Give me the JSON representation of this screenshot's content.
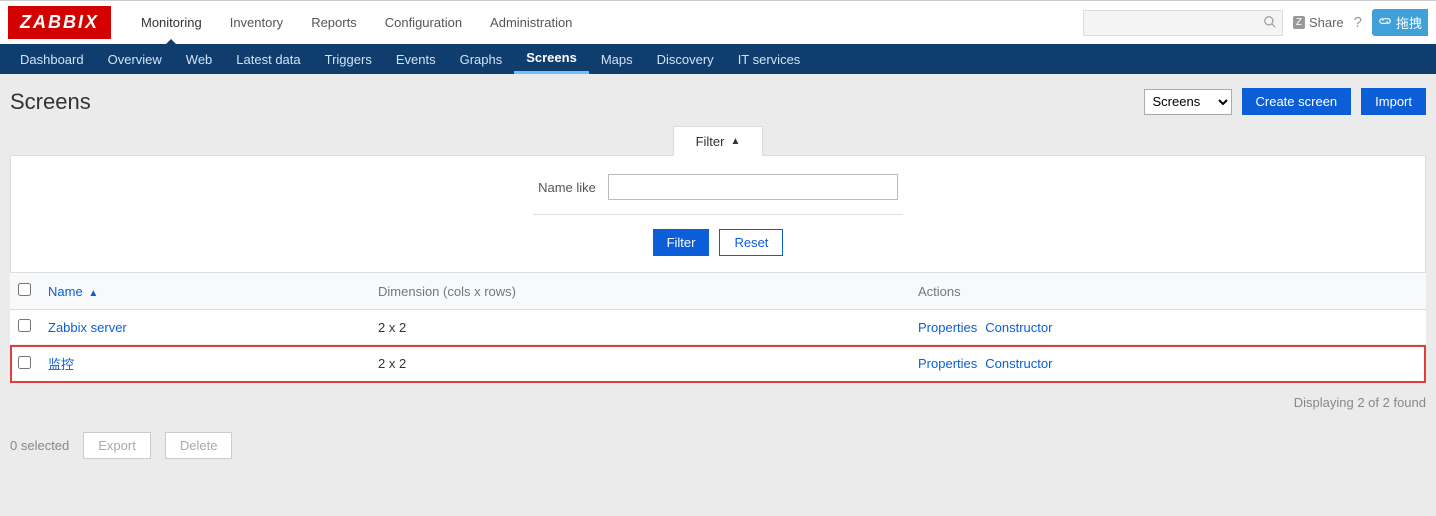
{
  "logo": "ZABBIX",
  "topnav": [
    "Monitoring",
    "Inventory",
    "Reports",
    "Configuration",
    "Administration"
  ],
  "topnav_active": 0,
  "share_label": "Share",
  "subnav": [
    "Dashboard",
    "Overview",
    "Web",
    "Latest data",
    "Triggers",
    "Events",
    "Graphs",
    "Screens",
    "Maps",
    "Discovery",
    "IT services"
  ],
  "subnav_active": 7,
  "page_title": "Screens",
  "kind_selected": "Screens",
  "create_label": "Create screen",
  "import_label": "Import",
  "filter": {
    "tab_label": "Filter",
    "name_like_label": "Name like",
    "name_like_value": "",
    "filter_btn": "Filter",
    "reset_btn": "Reset"
  },
  "table": {
    "col_name": "Name",
    "col_dimension": "Dimension (cols x rows)",
    "col_actions": "Actions",
    "rows": [
      {
        "name": "Zabbix server",
        "dimension": "2 x 2",
        "prop": "Properties",
        "cons": "Constructor",
        "hl": false
      },
      {
        "name": "监控",
        "dimension": "2 x 2",
        "prop": "Properties",
        "cons": "Constructor",
        "hl": true
      }
    ]
  },
  "footer_text": "Displaying 2 of 2 found",
  "bulk": {
    "selected_text": "0 selected",
    "export_label": "Export",
    "delete_label": "Delete"
  }
}
